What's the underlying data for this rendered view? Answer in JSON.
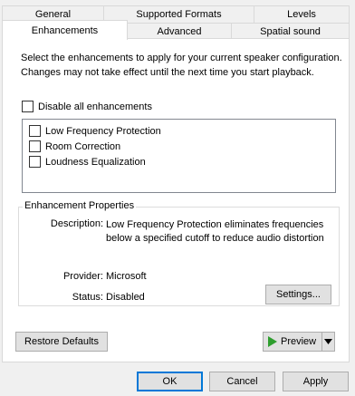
{
  "tabs_back": [
    "General",
    "Supported Formats",
    "Levels"
  ],
  "tabs_front": [
    "Enhancements",
    "Advanced",
    "Spatial sound"
  ],
  "intro_text": "Select the enhancements to apply for your current speaker configuration. Changes may not take effect until the next time you start playback.",
  "disable_all": {
    "label": "Disable all enhancements",
    "checked": false
  },
  "enhancements": [
    {
      "label": "Low Frequency Protection",
      "checked": false
    },
    {
      "label": "Room Correction",
      "checked": false
    },
    {
      "label": "Loudness Equalization",
      "checked": false
    }
  ],
  "properties": {
    "title": "Enhancement Properties",
    "description_label": "Description:",
    "description_value": "Low Frequency Protection eliminates frequencies below a specified cutoff to reduce audio distortion",
    "provider_label": "Provider:",
    "provider_value": "Microsoft",
    "status_label": "Status:",
    "status_value": "Disabled",
    "settings_button": "Settings..."
  },
  "restore_defaults_button": "Restore Defaults",
  "preview_button": "Preview",
  "footer": {
    "ok": "OK",
    "cancel": "Cancel",
    "apply": "Apply"
  },
  "colors": {
    "accent": "#0078d7",
    "play_icon": "#2e9e2e"
  }
}
